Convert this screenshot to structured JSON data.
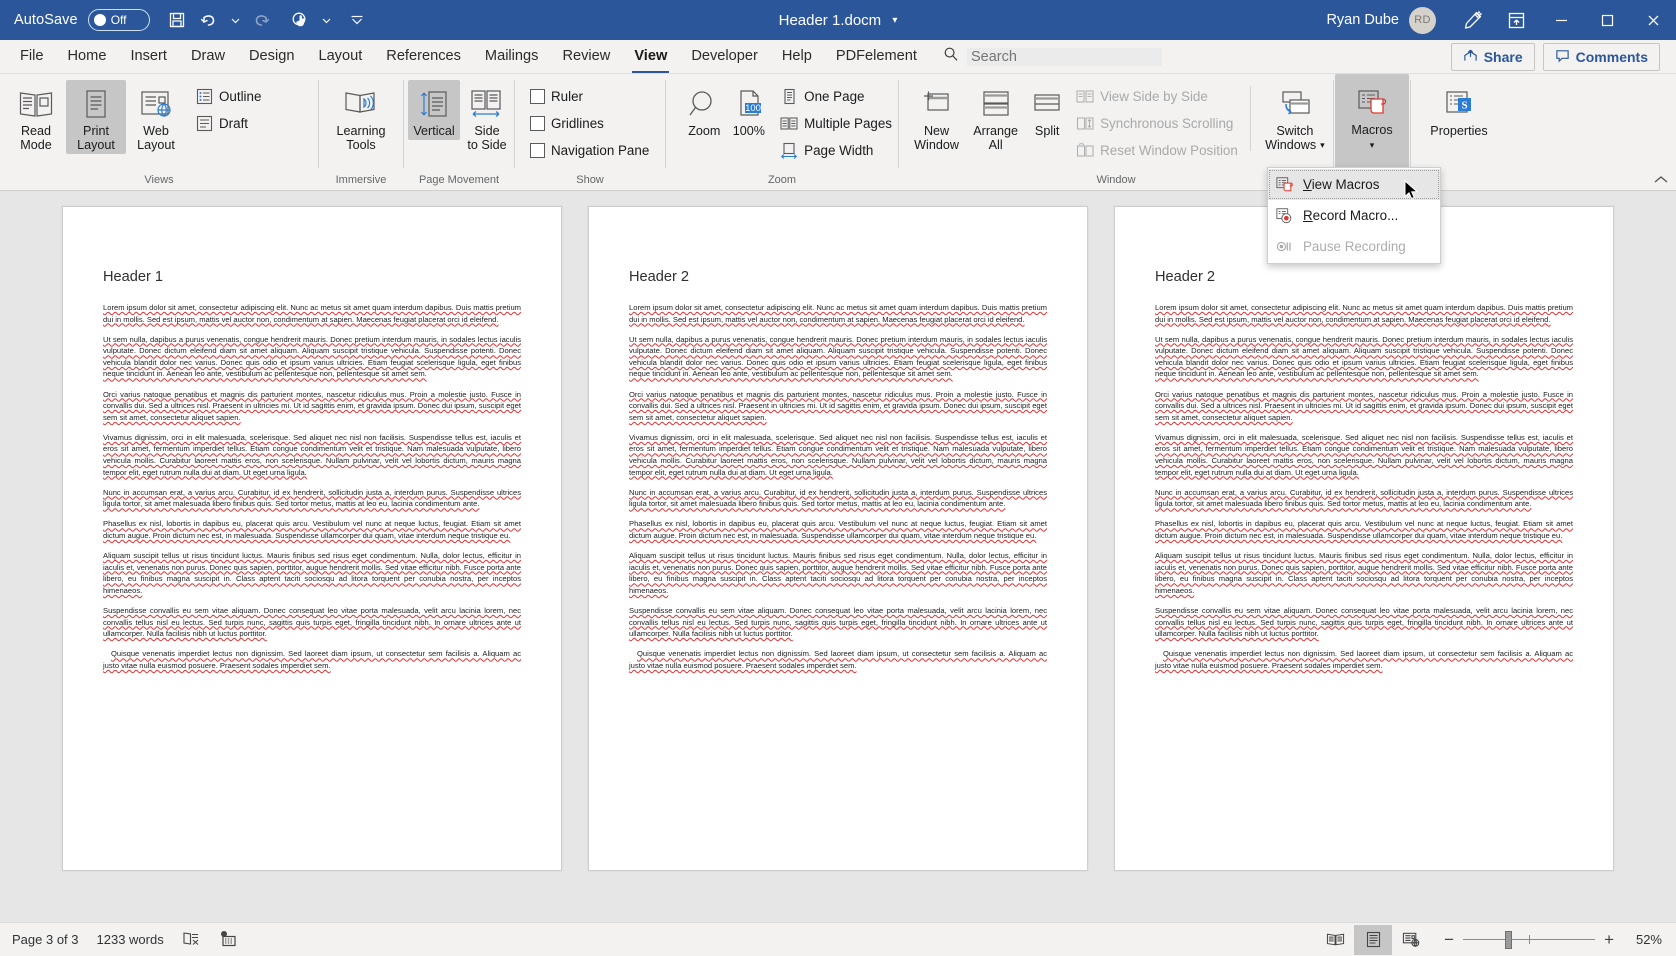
{
  "titlebar": {
    "autosave_label": "AutoSave",
    "autosave_state": "Off",
    "save_icon": "save-icon",
    "undo_icon": "undo-icon",
    "redo_icon": "redo-icon",
    "touch_icon": "touch-mode-icon",
    "customize_icon": "customize-quick-access-icon",
    "document_title": "Header 1.docm",
    "user_name": "Ryan Dube",
    "user_initials": "RD",
    "ink_icon": "pen-ink-icon",
    "ribbon_display_icon": "ribbon-display-options-icon",
    "minimize": "—",
    "maximize": "☐",
    "close": "✕"
  },
  "tabs": [
    {
      "label": "File",
      "active": false
    },
    {
      "label": "Home",
      "active": false
    },
    {
      "label": "Insert",
      "active": false
    },
    {
      "label": "Draw",
      "active": false
    },
    {
      "label": "Design",
      "active": false
    },
    {
      "label": "Layout",
      "active": false
    },
    {
      "label": "References",
      "active": false
    },
    {
      "label": "Mailings",
      "active": false
    },
    {
      "label": "Review",
      "active": false
    },
    {
      "label": "View",
      "active": true
    },
    {
      "label": "Developer",
      "active": false
    },
    {
      "label": "Help",
      "active": false
    },
    {
      "label": "PDFelement",
      "active": false
    }
  ],
  "search": {
    "placeholder": "Search",
    "icon": "search-icon"
  },
  "tabbar_right": {
    "share_label": "Share",
    "share_icon": "share-icon",
    "comments_label": "Comments",
    "comments_icon": "comment-icon"
  },
  "ribbon": {
    "collapse_icon": "collapse-ribbon-icon",
    "groups": [
      {
        "label": "Views",
        "buttons": [
          {
            "name": "read-mode",
            "label_line1": "Read",
            "label_line2": "Mode",
            "selected": false
          },
          {
            "name": "print-layout",
            "label_line1": "Print",
            "label_line2": "Layout",
            "selected": true
          },
          {
            "name": "web-layout",
            "label_line1": "Web",
            "label_line2": "Layout",
            "selected": false
          }
        ],
        "small_buttons": [
          {
            "name": "outline",
            "label": "Outline"
          },
          {
            "name": "draft",
            "label": "Draft"
          }
        ]
      },
      {
        "label": "Immersive",
        "buttons": [
          {
            "name": "learning-tools",
            "label_line1": "Learning",
            "label_line2": "Tools",
            "selected": false
          }
        ]
      },
      {
        "label": "Page Movement",
        "buttons": [
          {
            "name": "vertical",
            "label_line1": "Vertical",
            "label_line2": "",
            "selected": true
          },
          {
            "name": "side-to-side",
            "label_line1": "Side",
            "label_line2": "to Side",
            "selected": false
          }
        ]
      },
      {
        "label": "Show",
        "checkboxes": [
          {
            "name": "ruler",
            "label": "Ruler",
            "checked": false
          },
          {
            "name": "gridlines",
            "label": "Gridlines",
            "checked": false
          },
          {
            "name": "navigation-pane",
            "label": "Navigation Pane",
            "checked": false
          }
        ]
      },
      {
        "label": "Zoom",
        "buttons": [
          {
            "name": "zoom",
            "label_line1": "Zoom",
            "label_line2": "",
            "selected": false
          },
          {
            "name": "zoom-100",
            "label_line1": "100%",
            "label_line2": "",
            "selected": false
          }
        ],
        "small_buttons": [
          {
            "name": "one-page",
            "label": "One Page"
          },
          {
            "name": "multiple-pages",
            "label": "Multiple Pages"
          },
          {
            "name": "page-width",
            "label": "Page Width"
          }
        ]
      },
      {
        "label": "Window",
        "buttons": [
          {
            "name": "new-window",
            "label_line1": "New",
            "label_line2": "Window",
            "selected": false
          },
          {
            "name": "arrange-all",
            "label_line1": "Arrange",
            "label_line2": "All",
            "selected": false
          },
          {
            "name": "split",
            "label_line1": "Split",
            "label_line2": "",
            "selected": false
          },
          {
            "name": "switch-windows",
            "label_line1": "Switch",
            "label_line2": "Windows",
            "selected": false
          }
        ],
        "small_buttons": [
          {
            "name": "view-side-by-side",
            "label": "View Side by Side",
            "disabled": true
          },
          {
            "name": "synchronous-scrolling",
            "label": "Synchronous Scrolling",
            "disabled": true
          },
          {
            "name": "reset-window-position",
            "label": "Reset Window Position",
            "disabled": true
          }
        ]
      },
      {
        "label": "Macros",
        "buttons": [
          {
            "name": "macros",
            "label_line1": "Macros",
            "label_line2": "",
            "selected": true
          }
        ]
      },
      {
        "label": "",
        "buttons": [
          {
            "name": "properties",
            "label_line1": "Properties",
            "label_line2": "",
            "selected": false
          }
        ]
      }
    ]
  },
  "macros_menu": {
    "items": [
      {
        "name": "view-macros",
        "label": "View Macros",
        "accel": "V",
        "rest": "iew Macros",
        "icon": "view-macros-icon",
        "highlighted": true,
        "disabled": false
      },
      {
        "name": "record-macro",
        "label": "Record Macro...",
        "accel": "R",
        "rest": "ecord Macro...",
        "icon": "record-macro-icon",
        "highlighted": false,
        "disabled": false
      },
      {
        "name": "pause-recording",
        "label": "Pause Recording",
        "accel": "",
        "rest": "Pause Recording",
        "icon": "pause-recording-icon",
        "highlighted": false,
        "disabled": true
      }
    ]
  },
  "document": {
    "pages": [
      {
        "heading": "Header 1",
        "paragraphs": [
          "Lorem ipsum dolor sit amet, consectetur adipiscing elit. Nunc ac metus sit amet quam interdum dapibus. Duis mattis pretium dui in mollis. Sed est ipsum, mattis vel auctor non, condimentum at sapien. Maecenas feugiat placerat orci id eleifend.",
          "Ut sem nulla, dapibus a purus venenatis, congue hendrerit mauris. Donec pretium interdum mauris, in sodales lectus iaculis vulputate. Donec dictum eleifend diam sit amet aliquam. Aliquam suscipit tristique vehicula. Suspendisse potenti. Donec vehicula blandit dolor nec varius. Donec quis odio et ipsum varius ultricies. Etiam feugiat scelerisque ligula, eget finibus neque tincidunt in. Aenean leo ante, vestibulum ac pellentesque non, pellentesque sit amet sem.",
          "Orci varius natoque penatibus et magnis dis parturient montes, nascetur ridiculus mus. Proin a molestie justo. Fusce in convallis dui. Sed a ultrices nisl. Praesent in ultricies mi. Ut id sagittis enim, et gravida ipsum. Donec dui ipsum, suscipit eget sem sit amet, consectetur aliquet sapien.",
          "Vivamus dignissim, orci in elit malesuada, scelerisque. Sed aliquet nec nisl non facilisis. Suspendisse tellus est, iaculis et eros sit amet, fermentum imperdiet tellus. Etiam congue condimentum velit et tristique. Nam malesuada vulputate, libero vehicula mollis. Curabitur laoreet mattis eros, non scelerisque. Nullam pulvinar, velit vel lobortis dictum, mauris magna tempor elit, eget rutrum nulla dui at diam. Ut eget urna ligula.",
          "Nunc in accumsan erat, a varius arcu. Curabitur, id ex hendrerit, sollicitudin justa a, interdum purus. Suspendisse ultrices ligula tortor, sit amet malesuada libero finibus quis. Sed tortor metus, mattis at leo eu, lacinia condimentum ante.",
          "Phasellus ex nisl, lobortis in dapibus eu, placerat quis arcu. Vestibulum vel nunc at neque luctus, feugiat. Etiam sit amet dictum augue. Proin dictum nec est, in malesuada. Suspendisse ullamcorper dui quam, vitae interdum neque tristique eu.",
          "Aliquam suscipit tellus ut risus tincidunt luctus. Mauris finibus sed risus eget condimentum. Nulla, dolor lectus, efficitur in iaculis et, venenatis non purus. Donec quis sapien, porttitor, augue hendrerit mollis. Sed vitae efficitur nibh. Fusce porta ante libero, eu finibus magna suscipit in. Class aptent taciti sociosqu ad litora torquent per conubia nostra, per inceptos himenaeos.",
          "Suspendisse convallis eu sem vitae aliquam. Donec consequat leo vitae porta malesuada, velit arcu lacinia lorem, nec convallis tellus nisl eu lectus. Sed turpis nunc, sagittis quis turpis eget, fringilla tincidunt nibh. In ornare ultrices ante ut ullamcorper. Nulla facilisis nibh ut luctus porttitor.",
          "Quisque venenatis imperdiet lectus non dignissim. Sed laoreet diam ipsum, ut consectetur sem facilisis a. Aliquam ac justo vitae nulla euismod posuere. Praesent sodales imperdiet sem."
        ]
      },
      {
        "heading": "Header 2",
        "paragraphs": [
          "Lorem ipsum dolor sit amet, consectetur adipiscing elit. Nunc ac metus sit amet quam interdum dapibus. Duis mattis pretium dui in mollis. Sed est ipsum, mattis vel auctor non, condimentum at sapien. Maecenas feugiat placerat orci id eleifend.",
          "Ut sem nulla, dapibus a purus venenatis, congue hendrerit mauris. Donec pretium interdum mauris, in sodales lectus iaculis vulputate. Donec dictum eleifend diam sit amet aliquam. Aliquam suscipit tristique vehicula. Suspendisse potenti. Donec vehicula blandit dolor nec varius. Donec quis odio et ipsum varius ultricies. Etiam feugiat scelerisque ligula, eget finibus neque tincidunt in. Aenean leo ante, vestibulum ac pellentesque non, pellentesque sit amet sem.",
          "Orci varius natoque penatibus et magnis dis parturient montes, nascetur ridiculus mus. Proin a molestie justo. Fusce in convallis dui. Sed a ultrices nisl. Praesent in ultricies mi. Ut id sagittis enim, et gravida ipsum. Donec dui ipsum, suscipit eget sem sit amet, consectetur aliquet sapien.",
          "Vivamus dignissim, orci in elit malesuada, scelerisque. Sed aliquet nec nisl non facilisis. Suspendisse tellus est, iaculis et eros sit amet, fermentum imperdiet tellus. Etiam congue condimentum velit et tristique. Nam malesuada vulputate, libero vehicula mollis. Curabitur laoreet mattis eros, non scelerisque. Nullam pulvinar, velit vel lobortis dictum, mauris magna tempor elit, eget rutrum nulla dui at diam. Ut eget urna ligula.",
          "Nunc in accumsan erat, a varius arcu. Curabitur, id ex hendrerit, sollicitudin justa a, interdum purus. Suspendisse ultrices ligula tortor, sit amet malesuada libero finibus quis. Sed tortor metus, mattis at leo eu, lacinia condimentum ante.",
          "Phasellus ex nisl, lobortis in dapibus eu, placerat quis arcu. Vestibulum vel nunc at neque luctus, feugiat. Etiam sit amet dictum augue. Proin dictum nec est, in malesuada. Suspendisse ullamcorper dui quam, vitae interdum neque tristique eu.",
          "Aliquam suscipit tellus ut risus tincidunt luctus. Mauris finibus sed risus eget condimentum. Nulla, dolor lectus, efficitur in iaculis et, venenatis non purus. Donec quis sapien, porttitor, augue hendrerit mollis. Sed vitae efficitur nibh. Fusce porta ante libero, eu finibus magna suscipit in. Class aptent taciti sociosqu ad litora torquent per conubia nostra, per inceptos himenaeos.",
          "Suspendisse convallis eu sem vitae aliquam. Donec consequat leo vitae porta malesuada, velit arcu lacinia lorem, nec convallis tellus nisl eu lectus. Sed turpis nunc, sagittis quis turpis eget, fringilla tincidunt nibh. In ornare ultrices ante ut ullamcorper. Nulla facilisis nibh ut luctus porttitor.",
          "Quisque venenatis imperdiet lectus non dignissim. Sed laoreet diam ipsum, ut consectetur sem facilisis a. Aliquam ac justo vitae nulla euismod posuere. Praesent sodales imperdiet sem."
        ]
      },
      {
        "heading": "Header 2",
        "paragraphs": [
          "Lorem ipsum dolor sit amet, consectetur adipiscing elit. Nunc ac metus sit amet quam interdum dapibus. Duis mattis pretium dui in mollis. Sed est ipsum, mattis vel auctor non, condimentum at sapien. Maecenas feugiat placerat orci id eleifend.",
          "Ut sem nulla, dapibus a purus venenatis, congue hendrerit mauris. Donec pretium interdum mauris, in sodales lectus iaculis vulputate. Donec dictum eleifend diam sit amet aliquam. Aliquam suscipit tristique vehicula. Suspendisse potenti. Donec vehicula blandit dolor nec varius. Donec quis odio et ipsum varius ultricies. Etiam feugiat scelerisque ligula, eget finibus neque tincidunt in. Aenean leo ante, vestibulum ac pellentesque non, pellentesque sit amet sem.",
          "Orci varius natoque penatibus et magnis dis parturient montes, nascetur ridiculus mus. Proin a molestie justo. Fusce in convallis dui. Sed a ultrices nisl. Praesent in ultricies mi. Ut id sagittis enim, et gravida ipsum. Donec dui ipsum, suscipit eget sem sit amet, consectetur aliquet sapien.",
          "Vivamus dignissim, orci in elit malesuada, scelerisque. Sed aliquet nec nisl non facilisis. Suspendisse tellus est, iaculis et eros sit amet, fermentum imperdiet tellus. Etiam congue condimentum velit et tristique. Nam malesuada vulputate, libero vehicula mollis. Curabitur laoreet mattis eros, non scelerisque. Nullam pulvinar, velit vel lobortis dictum, mauris magna tempor elit, eget rutrum nulla dui at diam. Ut eget urna ligula.",
          "Nunc in accumsan erat, a varius arcu. Curabitur, id ex hendrerit, sollicitudin justa a, interdum purus. Suspendisse ultrices ligula tortor, sit amet malesuada libero finibus quis. Sed tortor metus, mattis at leo eu, lacinia condimentum ante.",
          "Phasellus ex nisl, lobortis in dapibus eu, placerat quis arcu. Vestibulum vel nunc at neque luctus, feugiat. Etiam sit amet dictum augue. Proin dictum nec est, in malesuada. Suspendisse ullamcorper dui quam, vitae interdum neque tristique eu.",
          "Aliquam suscipit tellus ut risus tincidunt luctus. Mauris finibus sed risus eget condimentum. Nulla, dolor lectus, efficitur in iaculis et, venenatis non purus. Donec quis sapien, porttitor, augue hendrerit mollis. Sed vitae efficitur nibh. Fusce porta ante libero, eu finibus magna suscipit in. Class aptent taciti sociosqu ad litora torquent per conubia nostra, per inceptos himenaeos.",
          "Suspendisse convallis eu sem vitae aliquam. Donec consequat leo vitae porta malesuada, velit arcu lacinia lorem, nec convallis tellus nisl eu lectus. Sed turpis nunc, sagittis quis turpis eget, fringilla tincidunt nibh. In ornare ultrices ante ut ullamcorper. Nulla facilisis nibh ut luctus porttitor.",
          "Quisque venenatis imperdiet lectus non dignissim. Sed laoreet diam ipsum, ut consectetur sem facilisis a. Aliquam ac justo vitae nulla euismod posuere. Praesent sodales imperdiet sem."
        ]
      }
    ]
  },
  "statusbar": {
    "page_info": "Page 3 of 3",
    "word_count": "1233 words",
    "proofing_icon": "proofing-errors-icon",
    "macro_record_icon": "macro-record-status-icon",
    "read_mode_icon": "read-mode-view-icon",
    "print_layout_icon": "print-layout-view-icon",
    "web_layout_icon": "web-layout-view-icon",
    "zoom_out": "−",
    "zoom_in": "+",
    "zoom_level": "52%"
  },
  "colors": {
    "word_blue": "#2b579a",
    "ribbon_bg": "#f3f2f1",
    "selected_gray": "#c6c6c6",
    "spell_error": "#e03030"
  }
}
